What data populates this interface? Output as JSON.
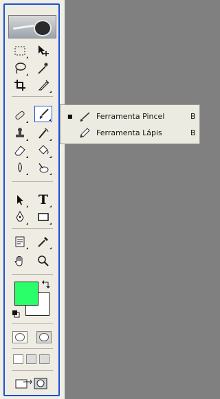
{
  "toolbox": {
    "tools": [
      {
        "id": "marquee",
        "icon": "rectangular-marquee-icon"
      },
      {
        "id": "move",
        "icon": "move-icon"
      },
      {
        "id": "lasso",
        "icon": "lasso-icon"
      },
      {
        "id": "magic-wand",
        "icon": "magic-wand-icon"
      },
      {
        "id": "crop",
        "icon": "crop-icon"
      },
      {
        "id": "slice",
        "icon": "slice-icon"
      },
      {
        "id": "healing",
        "icon": "healing-brush-icon"
      },
      {
        "id": "brush",
        "icon": "brush-icon"
      },
      {
        "id": "clone",
        "icon": "clone-stamp-icon"
      },
      {
        "id": "history-brush",
        "icon": "history-brush-icon"
      },
      {
        "id": "eraser",
        "icon": "eraser-icon"
      },
      {
        "id": "bucket",
        "icon": "paint-bucket-icon"
      },
      {
        "id": "blur",
        "icon": "blur-icon"
      },
      {
        "id": "dodge",
        "icon": "dodge-icon"
      },
      {
        "id": "path-select",
        "icon": "path-selection-icon"
      },
      {
        "id": "type",
        "icon": "type-icon"
      },
      {
        "id": "pen",
        "icon": "pen-icon"
      },
      {
        "id": "shape",
        "icon": "rectangle-shape-icon"
      },
      {
        "id": "notes",
        "icon": "notes-icon"
      },
      {
        "id": "eyedropper",
        "icon": "eyedropper-icon"
      },
      {
        "id": "hand",
        "icon": "hand-icon"
      },
      {
        "id": "zoom",
        "icon": "zoom-icon"
      }
    ],
    "type_glyph": "T",
    "foreground_color": "#2aff6a",
    "background_color": "#ffffff"
  },
  "flyout": {
    "items": [
      {
        "checked": true,
        "check_glyph": "■",
        "icon": "brush-icon",
        "label": "Ferramenta Pincel",
        "shortcut": "B"
      },
      {
        "checked": false,
        "check_glyph": "",
        "icon": "pencil-icon",
        "label": "Ferramenta Lápis",
        "shortcut": "B"
      }
    ]
  }
}
